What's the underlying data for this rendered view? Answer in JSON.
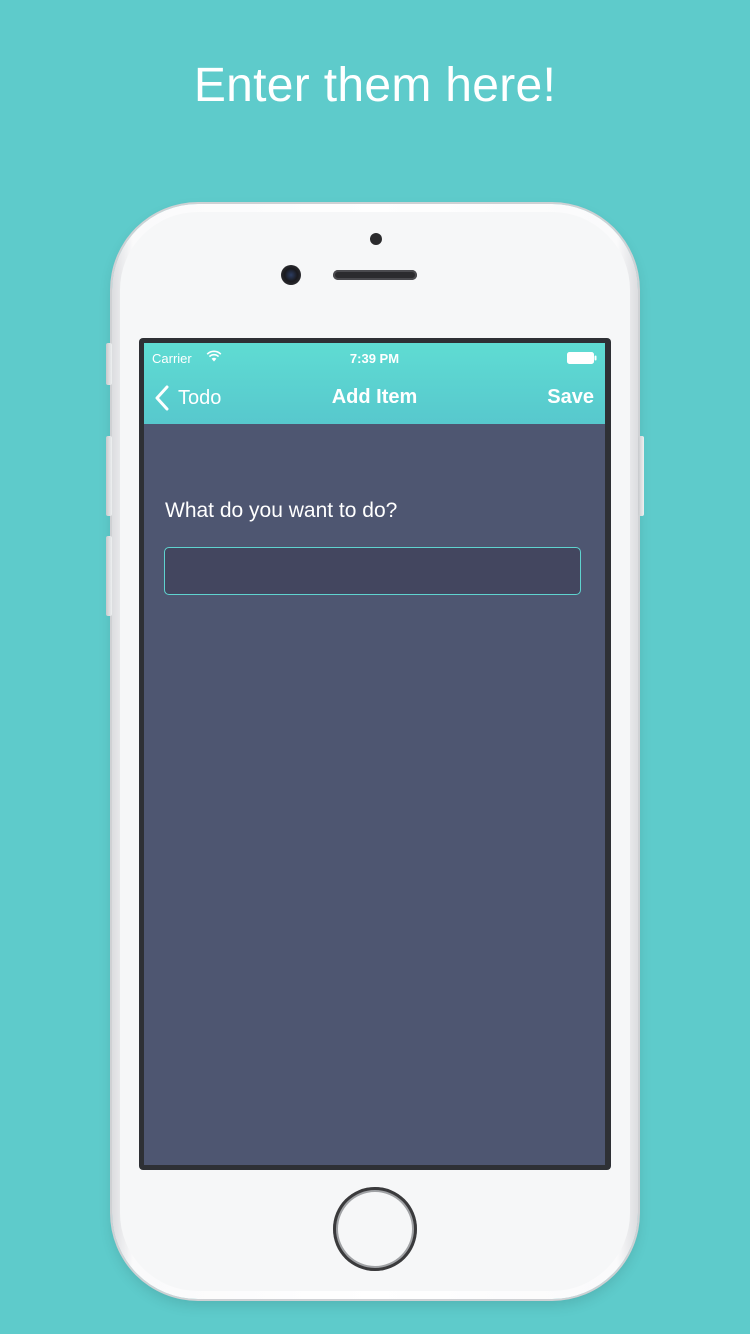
{
  "banner": {
    "headline": "Enter them here!"
  },
  "status_bar": {
    "carrier": "Carrier",
    "time": "7:39 PM",
    "wifi_icon": "wifi-icon",
    "battery_icon": "battery-icon"
  },
  "nav_bar": {
    "back_label": "Todo",
    "back_icon": "chevron-left-icon",
    "title": "Add Item",
    "save_label": "Save"
  },
  "form": {
    "prompt": "What do you want to do?",
    "input_value": "",
    "input_placeholder": ""
  },
  "colors": {
    "background": "#5ecbcb",
    "accent": "#5fdcd3",
    "screen_background": "#4e5671",
    "input_background": "#43465f",
    "input_border": "#5fd3cf"
  }
}
